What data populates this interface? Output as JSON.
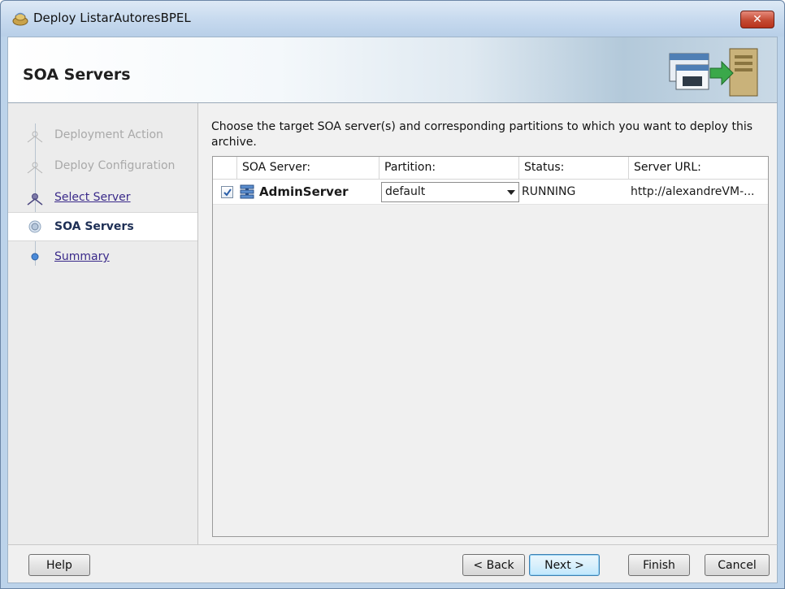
{
  "window": {
    "title": "Deploy ListarAutoresBPEL",
    "close_glyph": "✕"
  },
  "header": {
    "title": "SOA Servers",
    "art_icon": "deploy-to-server-icon"
  },
  "nav": {
    "items": [
      {
        "label": "Deployment Action",
        "state": "disabled"
      },
      {
        "label": "Deploy Configuration",
        "state": "disabled"
      },
      {
        "label": "Select Server",
        "state": "visited"
      },
      {
        "label": "SOA Servers",
        "state": "current"
      },
      {
        "label": "Summary",
        "state": "link"
      }
    ]
  },
  "main": {
    "instruction": "Choose the target SOA server(s) and corresponding partitions to which you want to deploy this archive.",
    "table": {
      "columns": [
        "SOA Server:",
        "Partition:",
        "Status:",
        "Server URL:"
      ],
      "rows": [
        {
          "checked": true,
          "server": "AdminServer",
          "partition": "default",
          "status": "RUNNING",
          "url": "http://alexandreVM-..."
        }
      ]
    }
  },
  "footer": {
    "help": "Help",
    "back": "< Back",
    "next": "Next >",
    "finish": "Finish",
    "cancel": "Cancel"
  },
  "colors": {
    "window_frame": "#bcd3ea",
    "close_red": "#c44a33",
    "link": "#3a2a8a",
    "primary_button_border": "#3c7fb1"
  }
}
